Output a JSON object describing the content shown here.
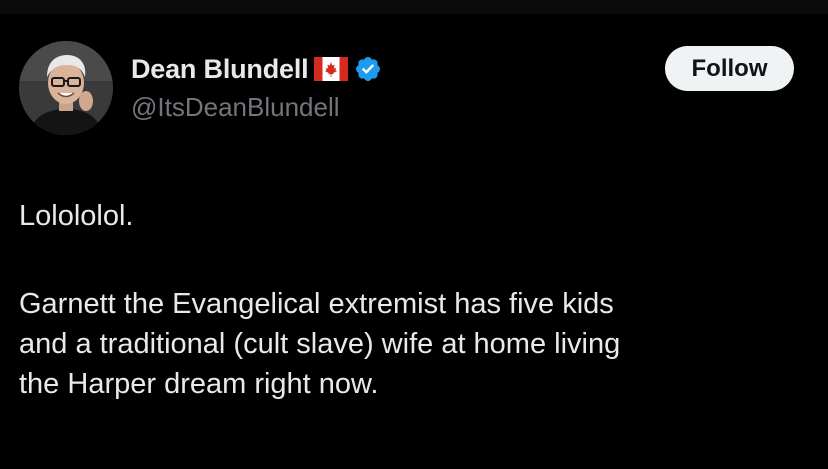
{
  "author": {
    "display_name": "Dean Blundell",
    "handle": "@ItsDeanBlundell",
    "flag_icon": "canada-flag-icon",
    "verified_icon": "verified-badge-icon",
    "verified_color": "#1d9bf0"
  },
  "follow_button": {
    "label": "Follow"
  },
  "tweet": {
    "paragraph_1": "Lolololol.",
    "paragraph_2": "Garnett the Evangelical extremist has five kids\nand a traditional (cult slave) wife at home living\nthe Harper dream right now."
  },
  "colors": {
    "background": "#000000",
    "text_primary": "#e7e9ea",
    "text_secondary": "#71767b",
    "button_bg": "#eff3f4"
  }
}
